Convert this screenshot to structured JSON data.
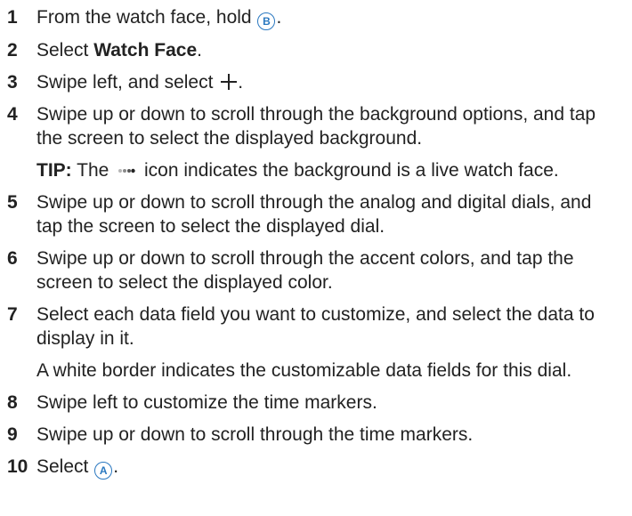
{
  "steps": [
    {
      "num": "1",
      "pre": "From the watch face, hold ",
      "button": "B",
      "post": "."
    },
    {
      "num": "2",
      "pre": "Select ",
      "bold": "Watch Face",
      "post": "."
    },
    {
      "num": "3",
      "pre": "Swipe left, and select ",
      "post": "."
    },
    {
      "num": "4",
      "text": "Swipe up or down to scroll through the background options, and tap the screen to select the displayed background.",
      "tip_label": "TIP:",
      "tip_pre": " The ",
      "tip_post": " icon indicates the background is a live watch face."
    },
    {
      "num": "5",
      "text": "Swipe up or down to scroll through the analog and digital dials, and tap the screen to select the displayed dial."
    },
    {
      "num": "6",
      "text": "Swipe up or down to scroll through the accent colors, and tap the screen to select the displayed color."
    },
    {
      "num": "7",
      "text": "Select each data field you want to customize, and select the data to display in it.",
      "note": "A white border indicates the customizable data fields for this dial."
    },
    {
      "num": "8",
      "text": "Swipe left to customize the time markers."
    },
    {
      "num": "9",
      "text": "Swipe up or down to scroll through the time markers."
    },
    {
      "num": "10",
      "pre": "Select ",
      "button": "A",
      "post": "."
    }
  ],
  "colors": {
    "text": "#222222",
    "button_icon": "#2a78c0"
  }
}
